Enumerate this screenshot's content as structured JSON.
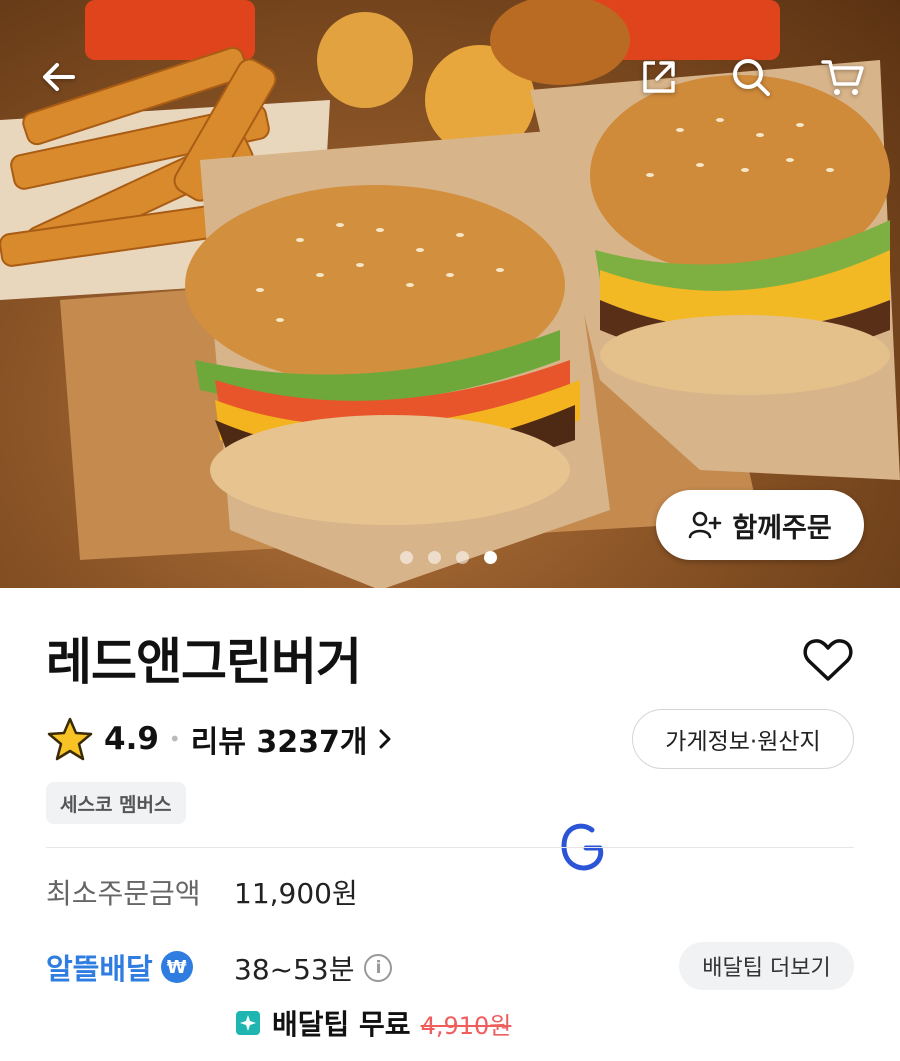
{
  "header": {
    "back_icon": "arrow-left-icon",
    "share_icon": "share-icon",
    "search_icon": "search-icon",
    "cart_icon": "cart-icon"
  },
  "hero": {
    "image_alt": "burgers and fries",
    "slides_total": 4,
    "active_slide": 4,
    "group_order_label": "함께주문",
    "group_order_icon": "person-add-icon"
  },
  "store": {
    "name": "레드앤그린버거",
    "favorite_icon": "heart-icon",
    "rating": "4.9",
    "reviews_label": "리뷰 3237개",
    "store_info_label": "가게정보·원산지",
    "member_badge": "세스코 멤버스"
  },
  "order": {
    "min_order_label": "최소주문금액",
    "min_order_value": "11,900원",
    "delivery_type_label": "알뜰배달",
    "delivery_time": "38~53분",
    "tip_more_label": "배달팁 더보기",
    "free_tip_label": "배달팁 무료",
    "original_tip": "4,910원"
  },
  "colors": {
    "accent_blue": "#2f7de1",
    "strike_red": "#f05d5d",
    "star_yellow": "#f7c325"
  }
}
